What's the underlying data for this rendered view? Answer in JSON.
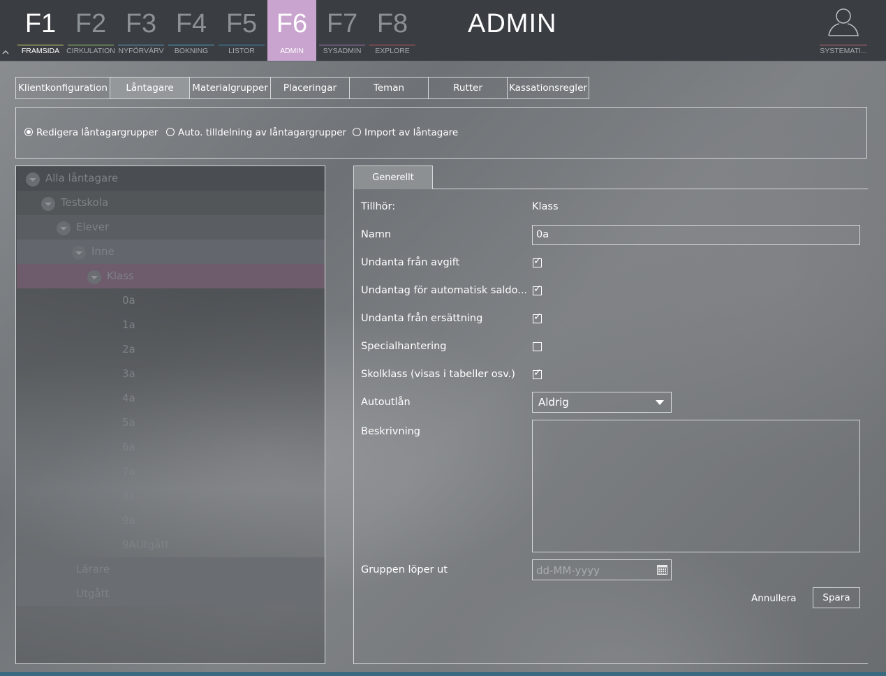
{
  "fkeys": [
    {
      "num": "F1",
      "label": "FRAMSIDA",
      "line": "#d4e06a"
    },
    {
      "num": "F2",
      "label": "CIRKULATION",
      "line": "#9fcf6a"
    },
    {
      "num": "F3",
      "label": "NYFÖRVÄRV",
      "line": "#5fa4c8"
    },
    {
      "num": "F4",
      "label": "BOKNING",
      "line": "#4fb0d0"
    },
    {
      "num": "F5",
      "label": "LISTOR",
      "line": "#3f93c9"
    },
    {
      "num": "F6",
      "label": "ADMIN",
      "line": "#c9a4cf"
    },
    {
      "num": "F7",
      "label": "SYSADMIN",
      "line": "#b07ab8"
    },
    {
      "num": "F8",
      "label": "EXPLORE",
      "line": "#c85a68"
    }
  ],
  "header": {
    "title": "ADMIN",
    "user_label": "SYSTEMATI..."
  },
  "tabs": [
    "Klientkonfiguration",
    "Låntagare",
    "Materialgrupper",
    "Placeringar",
    "Teman",
    "Rutter",
    "Kassationsregler"
  ],
  "active_tab": "Låntagare",
  "radios": [
    {
      "label": "Redigera låntagargrupper",
      "selected": true
    },
    {
      "label": "Auto. tilldelning av låntagargrupper",
      "selected": false
    },
    {
      "label": "Import av låntagare",
      "selected": false
    }
  ],
  "tree": [
    {
      "label": "Alla låntagare",
      "level": 0,
      "expander": true,
      "bg": "#4a4e52"
    },
    {
      "label": "Testskola",
      "level": 1,
      "expander": true,
      "bg": "#525659"
    },
    {
      "label": "Elever",
      "level": 2,
      "expander": true,
      "bg": "#5a5e62"
    },
    {
      "label": "Inne",
      "level": 3,
      "expander": true,
      "bg": "#63666c"
    },
    {
      "label": "Klass",
      "level": 4,
      "expander": true,
      "bg": "#6e5b6c",
      "selected": true
    },
    {
      "label": "0a",
      "level": 5,
      "expander": false
    },
    {
      "label": "1a",
      "level": 5,
      "expander": false
    },
    {
      "label": "2a",
      "level": 5,
      "expander": false
    },
    {
      "label": "3a",
      "level": 5,
      "expander": false
    },
    {
      "label": "4a",
      "level": 5,
      "expander": false
    },
    {
      "label": "5a",
      "level": 5,
      "expander": false
    },
    {
      "label": "6a",
      "level": 5,
      "expander": false
    },
    {
      "label": "7a",
      "level": 5,
      "expander": false
    },
    {
      "label": "8a",
      "level": 5,
      "expander": false
    },
    {
      "label": "9a",
      "level": 5,
      "expander": false
    },
    {
      "label": "9AUtgått",
      "level": 5,
      "expander": false
    },
    {
      "label": "Lärare",
      "level": 2,
      "expander": false,
      "bg": "#6a6d71"
    },
    {
      "label": "Utgått",
      "level": 2,
      "expander": false,
      "bg": "#6a6d71"
    }
  ],
  "detail": {
    "tab": "Generellt",
    "tillhor_label": "Tillhör:",
    "tillhor_value": "Klass",
    "namn_label": "Namn",
    "namn_value": "0a",
    "checks": [
      {
        "label": "Undanta från avgift",
        "checked": true
      },
      {
        "label": "Undantag för automatisk saldo...",
        "checked": true
      },
      {
        "label": "Undanta från ersättning",
        "checked": true
      },
      {
        "label": "Specialhantering",
        "checked": false
      },
      {
        "label": "Skolklass (visas i tabeller osv.)",
        "checked": true
      }
    ],
    "autoutlan_label": "Autoutlån",
    "autoutlan_value": "Aldrig",
    "beskrivning_label": "Beskrivning",
    "beskrivning_value": "",
    "expires_label": "Gruppen löper ut",
    "expires_placeholder": "dd-MM-yyyy",
    "cancel_label": "Annullera",
    "save_label": "Spara"
  },
  "icons": {
    "collapse": "chevron-up-icon",
    "user": "user-icon",
    "calendar": "calendar-icon",
    "dropdown": "caret-down-icon"
  }
}
